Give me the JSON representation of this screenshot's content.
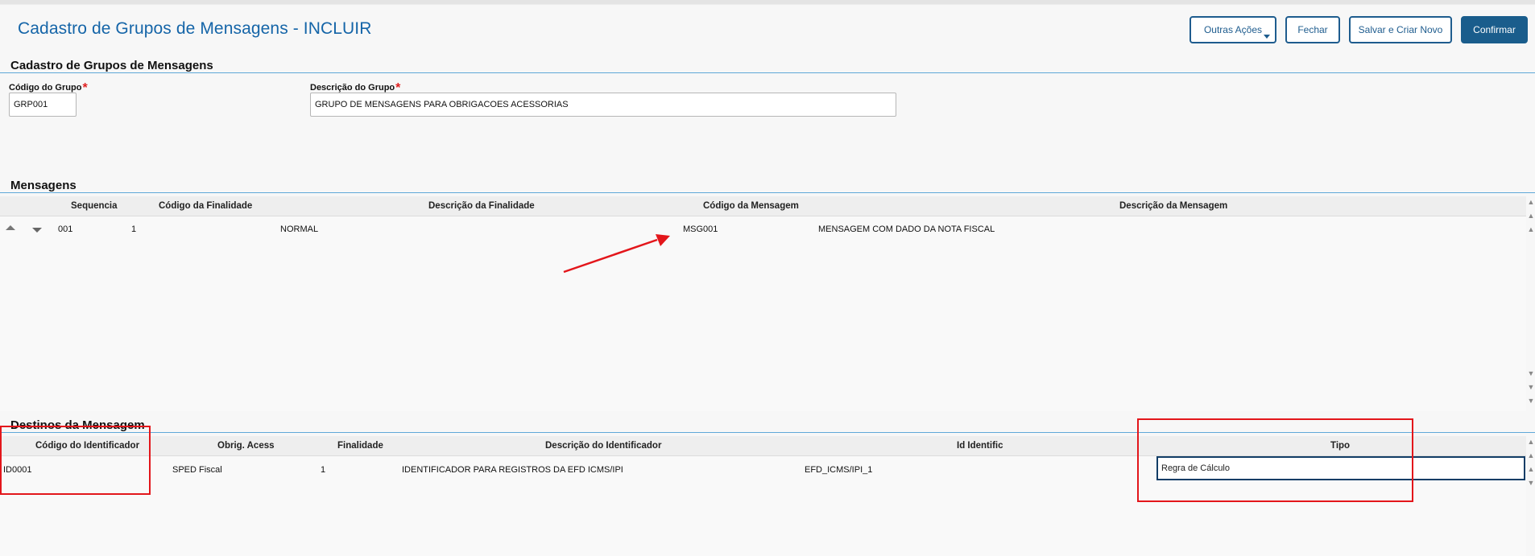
{
  "header": {
    "title": "Cadastro de Grupos de Mensagens - INCLUIR",
    "buttons": {
      "outras_acoes": "Outras Ações",
      "fechar": "Fechar",
      "salvar_criar_novo": "Salvar e Criar Novo",
      "confirmar": "Confirmar"
    }
  },
  "form": {
    "section_title": "Cadastro de Grupos de Mensagens",
    "codigo_label": "Código do Grupo",
    "codigo_value": "GRP001",
    "descricao_label": "Descrição do Grupo",
    "descricao_value": "GRUPO DE MENSAGENS PARA OBRIGACOES ACESSORIAS",
    "required_mark": "*"
  },
  "mensagens": {
    "section_title": "Mensagens",
    "columns": [
      "Sequencia",
      "Código da Finalidade",
      "Descrição da Finalidade",
      "Código da Mensagem",
      "Descrição da Mensagem"
    ],
    "rows": [
      {
        "sequencia": "001",
        "codigo_finalidade": "1",
        "descricao_finalidade": "NORMAL",
        "codigo_mensagem": "MSG001",
        "descricao_mensagem": "MENSAGEM COM DADO DA NOTA FISCAL"
      }
    ]
  },
  "destinos": {
    "section_title": "Destinos da Mensagem",
    "columns": [
      "Código do Identificador",
      "Obrig. Acess",
      "Finalidade",
      "Descrição do Identificador",
      "Id Identific",
      "Tipo"
    ],
    "rows": [
      {
        "codigo": "ID0001",
        "obrig": "SPED Fiscal",
        "finalidade": "1",
        "descricao": "IDENTIFICADOR PARA REGISTROS DA EFD ICMS/IPI",
        "id_identific": "EFD_ICMS/IPI_1",
        "tipo": "Regra de Cálculo"
      }
    ]
  },
  "colors": {
    "title_blue": "#1565a8",
    "primary_button": "#1a5d8c",
    "section_rule": "#5fa8d8",
    "annotation_red": "#e3161b"
  },
  "icons": [
    "dropdown-caret-icon",
    "sort-up-icon",
    "sort-down-icon",
    "scroll-up-icon",
    "scroll-down-icon",
    "annotation-arrow-icon"
  ]
}
